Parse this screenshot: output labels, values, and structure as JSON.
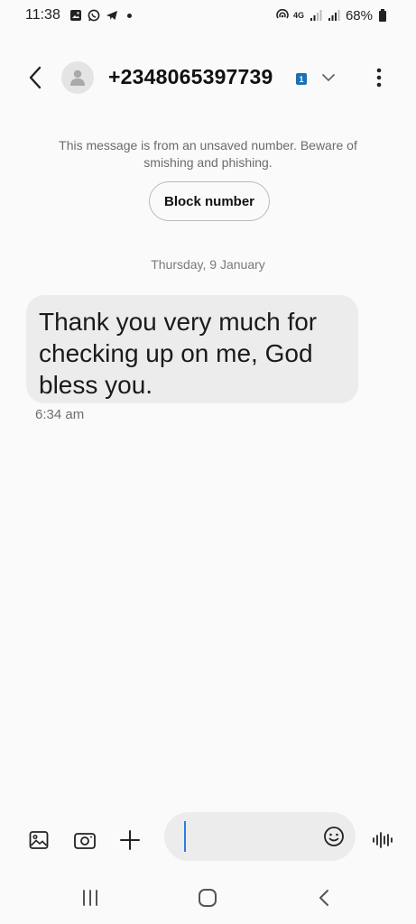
{
  "status_bar": {
    "time": "11:38",
    "network": "4G",
    "battery": "68%",
    "icons": [
      "gallery-icon",
      "whatsapp-icon",
      "telegram-icon",
      "notification-dot"
    ]
  },
  "header": {
    "contact": "+2348065397739",
    "sim_badge": "1"
  },
  "warning": {
    "text": "This message is from an unsaved number. Beware of smishing and phishing.",
    "block_label": "Block number"
  },
  "conversation": {
    "date": "Thursday, 9 January",
    "messages": [
      {
        "text": "Thank you very much for checking up on me, God bless you.",
        "time": "6:34 am"
      }
    ]
  },
  "compose": {
    "input_value": "",
    "icons": [
      "image-icon",
      "camera-icon",
      "plus-icon",
      "emoji-icon",
      "voice-icon"
    ]
  },
  "nav": {
    "buttons": [
      "recents-icon",
      "home-icon",
      "back-icon"
    ]
  },
  "colors": {
    "background": "#fafafa",
    "bubble": "#ececec",
    "accent": "#2a7de1",
    "sim_badge": "#1f6fb5"
  }
}
